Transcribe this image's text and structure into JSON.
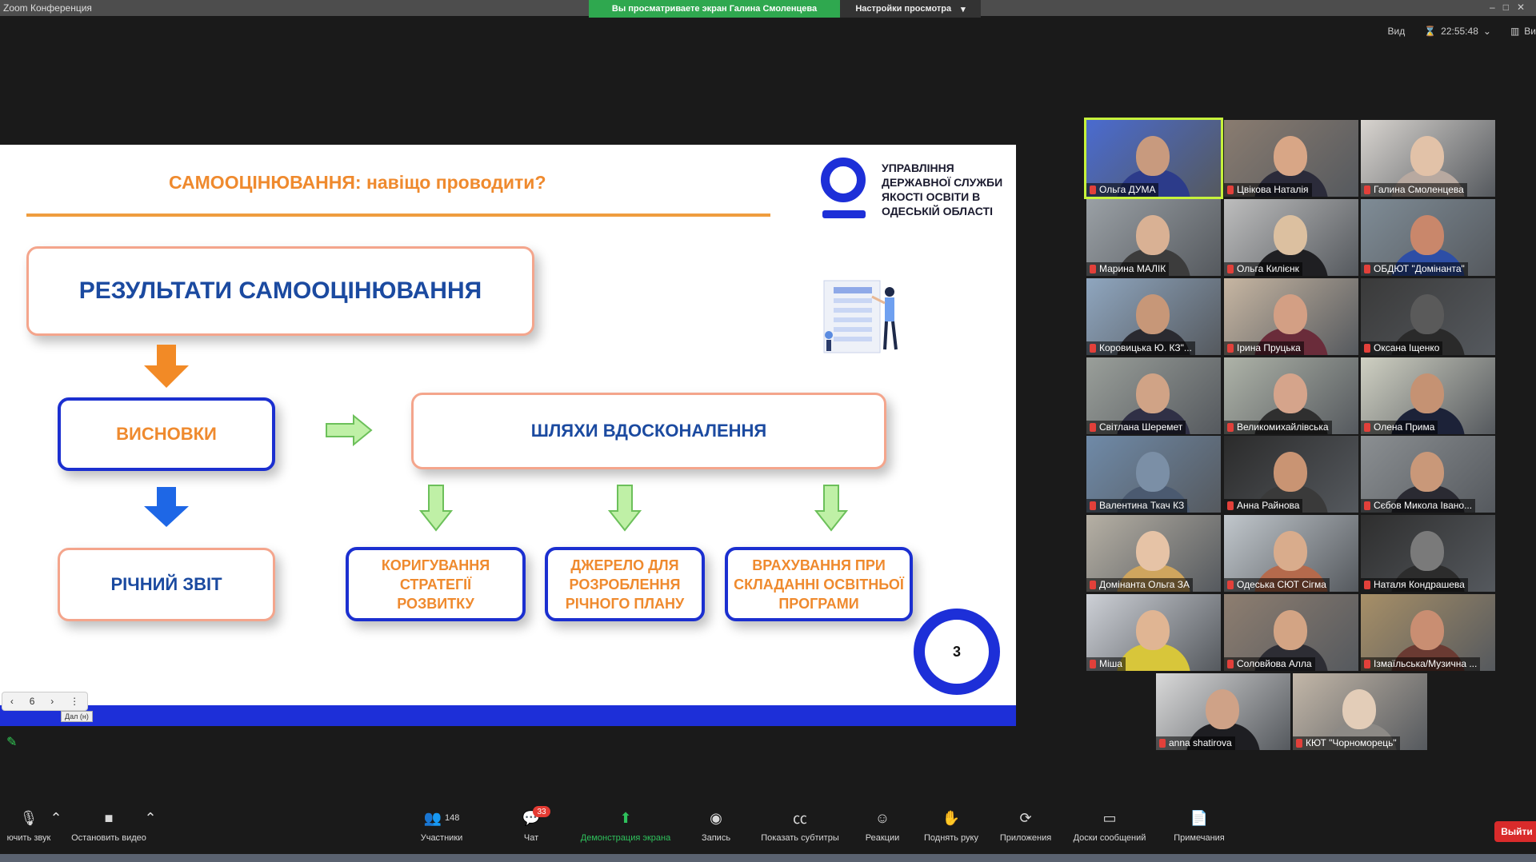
{
  "window": {
    "app_title": "Zoom Конференция",
    "viewing_banner": "Вы просматриваете экран Галина Смоленцева",
    "view_options": "Настройки просмотра",
    "view_label": "Вид",
    "time": "22:55:48",
    "gallery_label": "Ви"
  },
  "slide": {
    "title": "САМООЦІНЮВАННЯ: навіщо проводити?",
    "org_name": "Управління державної служби якості освіти в Одеській області",
    "results": "РЕЗУЛЬТАТИ САМООЦІНЮВАННЯ",
    "conclusions": "ВИСНОВКИ",
    "annual_report": "РІЧНИЙ ЗВІТ",
    "ways": "ШЛЯХИ ВДОСКОНАЛЕННЯ",
    "correction_1": "КОРИГУВАННЯ",
    "correction_2": "СТРАТЕГІЇ",
    "correction_3": "РОЗВИТКУ",
    "source_1": "ДЖЕРЕЛО ДЛЯ",
    "source_2": "РОЗРОБЛЕННЯ",
    "source_3": "РІЧНОГО ПЛАНУ",
    "account_1": "ВРАХУВАННЯ ПРИ",
    "account_2": "СКЛАДАННІ ОСВІТНЬОЇ",
    "account_3": "ПРОГРАМИ",
    "page_number": "3",
    "nav_page": "6",
    "nav_tooltip": "Дал (н)"
  },
  "participants": [
    {
      "name": "Ольга ДУМА",
      "active": true,
      "skin": "#c89a7e",
      "shirt": "#2c3b8a",
      "bg": "#4a6bd0"
    },
    {
      "name": "Цвікова Наталія",
      "active": false,
      "skin": "#d8a686",
      "shirt": "#2b2b3a",
      "bg": "#8a7c70"
    },
    {
      "name": "Галина Смоленцева",
      "active": false,
      "skin": "#e2c2a8",
      "shirt": "#b8a9a0",
      "bg": "#d8d4cf"
    },
    {
      "name": "Марина МАЛІК",
      "active": false,
      "skin": "#d9b194",
      "shirt": "#3c3c3c",
      "bg": "#9aa0a5"
    },
    {
      "name": "Ольга Килієнк",
      "active": false,
      "skin": "#dcc0a0",
      "shirt": "#1f1f22",
      "bg": "#bdbdbd"
    },
    {
      "name": "ОБДЮТ \"Домінанта\"",
      "active": false,
      "skin": "#c9876b",
      "shirt": "#2d4ea6",
      "bg": "#7f8c96"
    },
    {
      "name": "Коровицька Ю. КЗ\"...",
      "active": false,
      "skin": "#c79778",
      "shirt": "#2a2a30",
      "bg": "#8fa6bf"
    },
    {
      "name": "Ірина Пруцька",
      "active": false,
      "skin": "#d39f84",
      "shirt": "#6a2c3a",
      "bg": "#c7b6a2"
    },
    {
      "name": "Оксана Іщенко",
      "active": false,
      "skin": "#5a5a5a",
      "shirt": "#2a2a2a",
      "bg": "#3a3a3a"
    },
    {
      "name": "Світлана Шеремет",
      "active": false,
      "skin": "#d0a386",
      "shirt": "#303046",
      "bg": "#9a9f9a"
    },
    {
      "name": "Великомихайлівська",
      "active": false,
      "skin": "#d5a48b",
      "shirt": "#2f2f2f",
      "bg": "#aeb3a8"
    },
    {
      "name": "Олена Прима",
      "active": false,
      "skin": "#c59273",
      "shirt": "#1c2238",
      "bg": "#cfd0c2"
    },
    {
      "name": "Валентина Ткач КЗ",
      "active": false,
      "skin": "#7b8fa6",
      "shirt": "#4b5a70",
      "bg": "#6f8aa8"
    },
    {
      "name": "Анна Райнова",
      "active": false,
      "skin": "#c99473",
      "shirt": "#3a3a3a",
      "bg": "#2b2b2b"
    },
    {
      "name": "Сєбов Микола Івано...",
      "active": false,
      "skin": "#c99879",
      "shirt": "#2a2a32",
      "bg": "#8b8f92"
    },
    {
      "name": "Домінанта Ольга ЗА",
      "active": false,
      "skin": "#e6c3a6",
      "shirt": "#cfa55e",
      "bg": "#b6b0a4"
    },
    {
      "name": "Одеська СЮТ Сігма",
      "active": false,
      "skin": "#d9ac8c",
      "shirt": "#b56a4c",
      "bg": "#c1c7cc"
    },
    {
      "name": "Наталя Кондрашева",
      "active": false,
      "skin": "#7a7a7a",
      "shirt": "#2c2c2c",
      "bg": "#2e2e2e"
    },
    {
      "name": "Міша",
      "active": false,
      "skin": "#e0b593",
      "shirt": "#d8c63a",
      "bg": "#cdd0d6"
    },
    {
      "name": "Соловйова Алла",
      "active": false,
      "skin": "#d3a484",
      "shirt": "#2d2d34",
      "bg": "#8e7e70"
    },
    {
      "name": "Ізмаїльська/Музична ...",
      "active": false,
      "skin": "#c98e72",
      "shirt": "#6a3a32",
      "bg": "#a78f67"
    },
    {
      "name": "anna shatirova",
      "active": false,
      "skin": "#cfa287",
      "shirt": "#1e1e22",
      "bg": "#d9d9d9"
    },
    {
      "name": "КЮТ \"Чорноморець\"",
      "active": false,
      "skin": "#e3cdb8",
      "shirt": "#8d8a86",
      "bg": "#c3b7a8"
    }
  ],
  "toolbar": {
    "mute": "ючить звук",
    "stop_video": "Остановить видео",
    "participants": "Участники",
    "participants_count": "148",
    "chat": "Чат",
    "chat_badge": "33",
    "share": "Демонстрация экрана",
    "record": "Запись",
    "captions": "Показать субтитры",
    "reactions": "Реакции",
    "raise_hand": "Поднять руку",
    "apps": "Приложения",
    "whiteboards": "Доски сообщений",
    "notes": "Примечания",
    "leave": "Выйти"
  },
  "colors": {
    "accent_orange": "#ef8a2e",
    "accent_blue": "#1d2fd8",
    "share_green": "#2fc15c",
    "leave_red": "#d92b2b"
  }
}
